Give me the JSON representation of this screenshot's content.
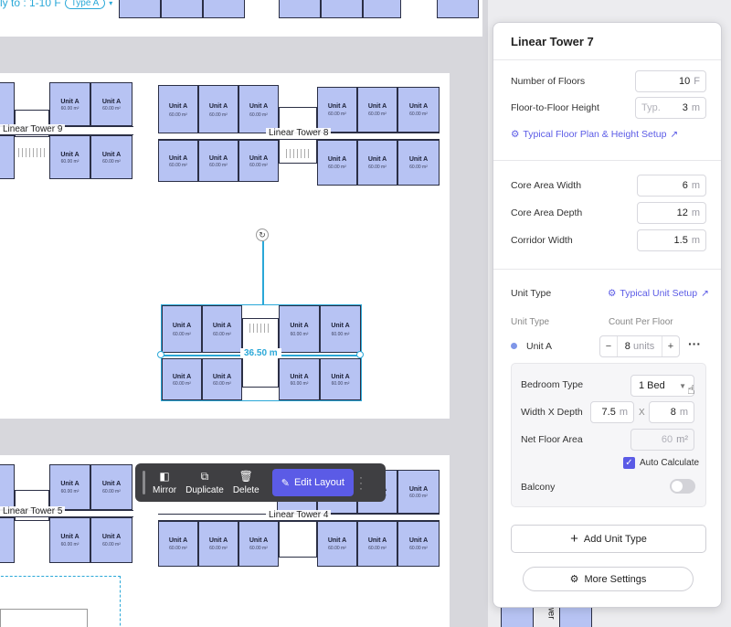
{
  "topbar": {
    "apply_text": "ly to : 1-10 F",
    "type_pill": "Type A"
  },
  "units": {
    "name": "Unit A",
    "area": "60.00 m²"
  },
  "towers": {
    "t9": "Linear Tower 9",
    "t8": "Linear Tower 8",
    "t5": "Linear Tower 5",
    "t4": "Linear Tower 4",
    "partial": "wer"
  },
  "selection": {
    "dimension": "36.50 m"
  },
  "toolbar": {
    "mirror": "Mirror",
    "duplicate": "Duplicate",
    "delete": "Delete",
    "edit_layout": "Edit Layout"
  },
  "panel": {
    "title": "Linear Tower 7",
    "floors": {
      "label": "Number of Floors",
      "value": "10",
      "unit": "F"
    },
    "ftf": {
      "label": "Floor-to-Floor Height",
      "placeholder": "Typ.",
      "value": "3",
      "unit": "m"
    },
    "typical_floor_link": "Typical Floor Plan & Height Setup",
    "core_width": {
      "label": "Core Area Width",
      "value": "6",
      "unit": "m"
    },
    "core_depth": {
      "label": "Core Area Depth",
      "value": "12",
      "unit": "m"
    },
    "corridor": {
      "label": "Corridor Width",
      "value": "1.5",
      "unit": "m"
    },
    "unit_type_heading": "Unit Type",
    "typical_unit_link": "Typical Unit Setup",
    "col_unit_type": "Unit Type",
    "col_count": "Count Per Floor",
    "unit_row": {
      "name": "Unit A",
      "count": "8",
      "unit": "units",
      "color": "#7f96e8"
    },
    "bedroom": {
      "label": "Bedroom Type",
      "value": "1 Bed"
    },
    "wxd": {
      "label": "Width X Depth",
      "width": "7.5",
      "depth": "8",
      "unit": "m",
      "x": "X"
    },
    "nfa": {
      "label": "Net Floor Area",
      "value": "60",
      "unit": "m²"
    },
    "auto_calc": "Auto Calculate",
    "balcony": "Balcony",
    "add_unit_type": "Add Unit Type",
    "more_settings": "More Settings"
  },
  "colors": {
    "accent": "#5b5be6",
    "selection": "#2aa8d8",
    "unit_fill": "#b7c3f3"
  }
}
